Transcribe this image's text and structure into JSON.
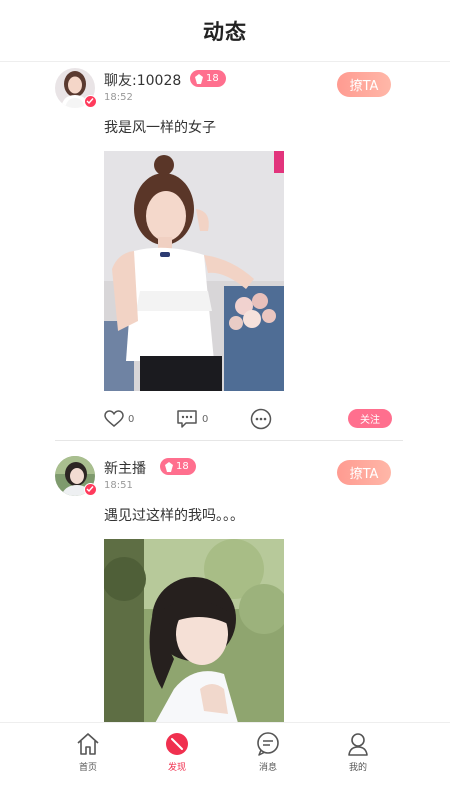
{
  "header": {
    "title": "动态"
  },
  "posts": [
    {
      "username": "聊友:10028",
      "level": "18",
      "time": "18:52",
      "chat_label": "撩TA",
      "text": "我是风一样的女子",
      "likes": "0",
      "comments": "0",
      "follow_label": "关注"
    },
    {
      "username": "新主播",
      "level": "18",
      "time": "18:51",
      "chat_label": "撩TA",
      "text": "遇见过这样的我吗。。。"
    }
  ],
  "tabs": [
    {
      "label": "首页",
      "icon": "home-icon"
    },
    {
      "label": "发现",
      "icon": "discover-icon",
      "active": true
    },
    {
      "label": "消息",
      "icon": "message-icon"
    },
    {
      "label": "我的",
      "icon": "profile-icon"
    }
  ],
  "colors": {
    "accent": "#ff6f8e",
    "chat_gradient_start": "#ff9b91",
    "tab_active": "#f0304f"
  }
}
